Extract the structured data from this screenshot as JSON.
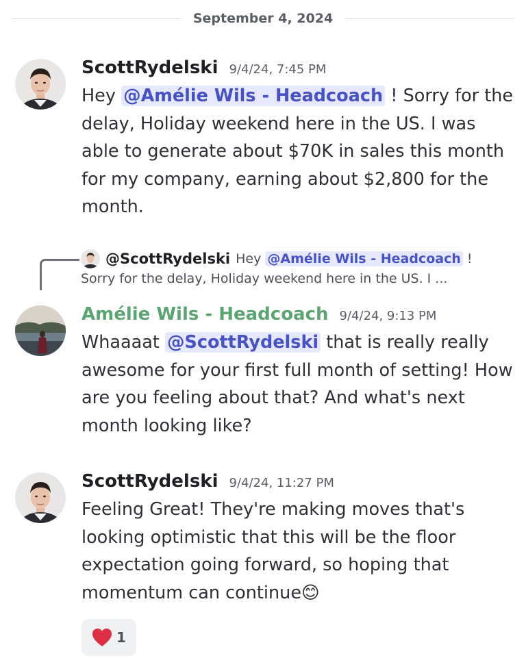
{
  "divider": {
    "date": "September 4, 2024"
  },
  "messages": [
    {
      "author": "ScottRydelski",
      "timestamp": "9/4/24, 7:45 PM",
      "before": "Hey ",
      "mention": "@Amélie Wils - Headcoach",
      "after": " ! Sorry for the delay, Holiday weekend here in the US. I was able to generate about $70K in sales this month for my company, earning about $2,800 for the month."
    },
    {
      "author": "Amélie Wils - Headcoach",
      "timestamp": "9/4/24, 9:13 PM",
      "before": "Whaaaat ",
      "mention": "@ScottRydelski",
      "after": " that is really really awesome for your first full month of setting! How are you feeling about that? And what's next month looking like?"
    },
    {
      "author": "ScottRydelski",
      "timestamp": "9/4/24, 11:27 PM",
      "text": "Feeling Great! They're making moves that's looking optimistic that this will be the floor expectation going forward, so hoping that momentum can continue",
      "emoji": "😊"
    }
  ],
  "reply": {
    "author": "@ScottRydelski",
    "text_before": "Hey ",
    "mention": "@Amélie Wils - Headcoach",
    "text_after": " !",
    "line2": "Sorry for the delay, Holiday weekend here in the US. I ..."
  },
  "reaction": {
    "emoji": "❤️",
    "count": "1"
  },
  "colors": {
    "mention_bg": "#e6e8fd",
    "mention_text": "#4752c4",
    "coach_name": "#5aa572",
    "reaction_bg": "#f0f1f3"
  },
  "icons": {
    "avatar_scott": "man-portrait-avatar",
    "avatar_amelie": "woman-lakeside-avatar",
    "reply_spine": "reply-connector-icon"
  }
}
